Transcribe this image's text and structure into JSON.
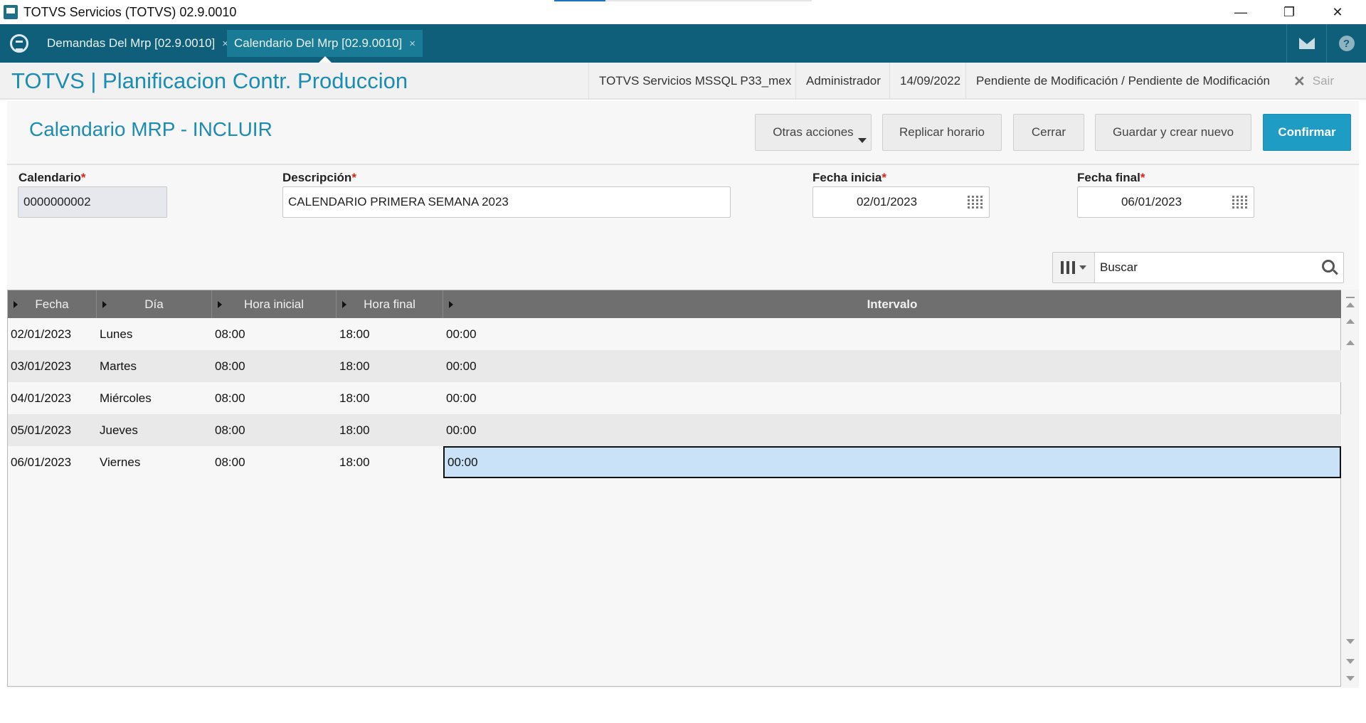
{
  "window": {
    "title": "TOTVS Servicios (TOTVS) 02.9.0010",
    "progress_fraction": 0.2,
    "minimize": "—",
    "restore": "❐",
    "close": "✕"
  },
  "tabs": [
    {
      "label": "Demandas Del Mrp [02.9.0010]",
      "close": "×"
    },
    {
      "label": "Calendario Del Mrp [02.9.0010]",
      "close": "×"
    }
  ],
  "header": {
    "brand": "TOTVS | Planificacion Contr. Produccion",
    "environment": "TOTVS Servicios MSSQL P33_mex",
    "user": "Administrador",
    "date": "14/09/2022",
    "status": "Pendiente de Modificación / Pendiente de Modificación",
    "logout_label": "Sair"
  },
  "toolbar": {
    "page_title": "Calendario MRP - INCLUIR",
    "other_actions": "Otras acciones",
    "replicate": "Replicar horario",
    "close": "Cerrar",
    "save_new": "Guardar y crear nuevo",
    "confirm": "Confirmar"
  },
  "form": {
    "calendar_label": "Calendario",
    "calendar_value": "0000000002",
    "description_label": "Descripción",
    "description_value": "CALENDARIO PRIMERA SEMANA 2023",
    "start_label": "Fecha inicia",
    "start_value": "02/01/2023",
    "end_label": "Fecha final",
    "end_value": "06/01/2023",
    "required_mark": "*"
  },
  "search": {
    "placeholder": "Buscar"
  },
  "grid": {
    "columns": [
      "Fecha",
      "Día",
      "Hora inicial",
      "Hora final",
      "Intervalo"
    ],
    "rows": [
      [
        "02/01/2023",
        "Lunes",
        "08:00",
        "18:00",
        "00:00"
      ],
      [
        "03/01/2023",
        "Martes",
        "08:00",
        "18:00",
        "00:00"
      ],
      [
        "04/01/2023",
        "Miércoles",
        "08:00",
        "18:00",
        "00:00"
      ],
      [
        "05/01/2023",
        "Jueves",
        "08:00",
        "18:00",
        "00:00"
      ],
      [
        "06/01/2023",
        "Viernes",
        "08:00",
        "18:00",
        "00:00"
      ]
    ]
  },
  "colors": {
    "tabbar": "#0f5f7a",
    "accent": "#1c8cb3",
    "primary_button": "#1e9cc4",
    "selected_cell": "#c9e2f8"
  }
}
